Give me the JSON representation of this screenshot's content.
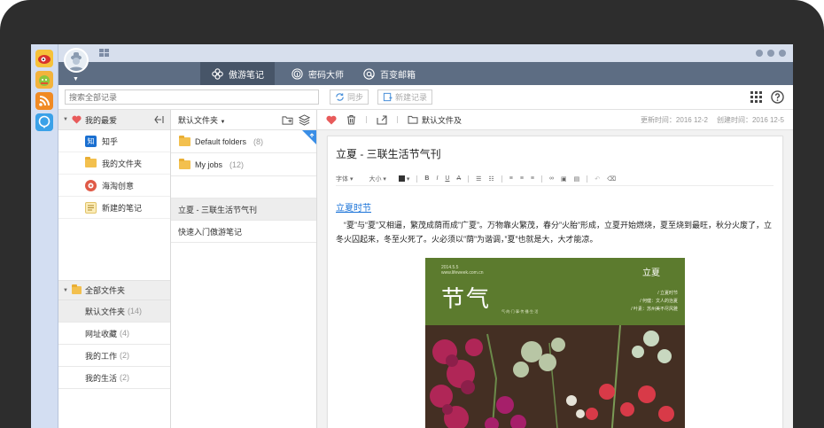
{
  "dock": {
    "icons": [
      "weibo-icon",
      "android-icon",
      "rss-icon",
      "chat-icon"
    ]
  },
  "nav": {
    "tabs": [
      {
        "label": "傲游笔记",
        "icon": "flower-icon",
        "active": true
      },
      {
        "label": "密码大师",
        "icon": "fingerprint-icon",
        "active": false
      },
      {
        "label": "百变邮箱",
        "icon": "at-icon",
        "active": false
      }
    ]
  },
  "search": {
    "placeholder": "搜索全部记录",
    "sync_label": "同步",
    "new_label": "新建记录"
  },
  "favorites": {
    "title": "我的最爱",
    "items": [
      {
        "label": "知乎",
        "icon": "zhihu-icon",
        "color": "#1a6fd0",
        "glyph": "知"
      },
      {
        "label": "我的文件夹",
        "icon": "folder-icon",
        "color": "#f3c04e",
        "glyph": ""
      },
      {
        "label": "海淘创意",
        "icon": "haitao-icon",
        "color": "#e05a47",
        "glyph": "◉"
      },
      {
        "label": "新建的笔记",
        "icon": "note-icon",
        "color": "#f5d98a",
        "glyph": "≡"
      }
    ]
  },
  "folders": {
    "title": "全部文件夹",
    "items": [
      {
        "label": "默认文件夹",
        "count": "(14)"
      },
      {
        "label": "网址收藏",
        "count": "(4)"
      },
      {
        "label": "我的工作",
        "count": "(2)"
      },
      {
        "label": "我的生活",
        "count": "(2)"
      }
    ]
  },
  "list": {
    "header": "默认文件夹",
    "subfolders": [
      {
        "label": "Default folders",
        "count": "(8)"
      },
      {
        "label": "My jobs",
        "count": "(12)"
      }
    ],
    "notes": [
      {
        "label": "立夏 - 三联生活节气刊"
      },
      {
        "label": "快速入门傲游笔记"
      }
    ]
  },
  "note": {
    "folder": "默认文件及",
    "updated": "更新时间：2016 12-2",
    "created": "创建时间：2016 12-5",
    "title": "立夏 - 三联生活节气刊",
    "link": "立夏时节",
    "body": "“夏”与“夏”又相逼，繁茂成荫而成”广夏”。万物靠火繁茂，春分”火胎”形成，立夏开始燃烧，夏至烧到最旺，秋分火废了，立冬火囚起来，冬至火死了。火必须以”荫”为谐调，”夏”也就是大，大才能凉。",
    "format": {
      "font": "字体",
      "size": "大小"
    }
  },
  "magazine": {
    "date": "2014.5.5",
    "site": "www.lifeweek.com.cn",
    "title": "节气",
    "subtitle": "气·的·门·事·传·播·生·活",
    "term": "立夏",
    "lines": [
      "/ 立夏时节",
      "/ 何健：文人的治夏",
      "/ 叶素：苏州美不尽风雅"
    ]
  },
  "colors": {
    "nav": "#5d6d83",
    "nav_active": "#475568",
    "link": "#1a73d8",
    "heart": "#e85b5b",
    "magazine_green": "#5c7b2e"
  }
}
